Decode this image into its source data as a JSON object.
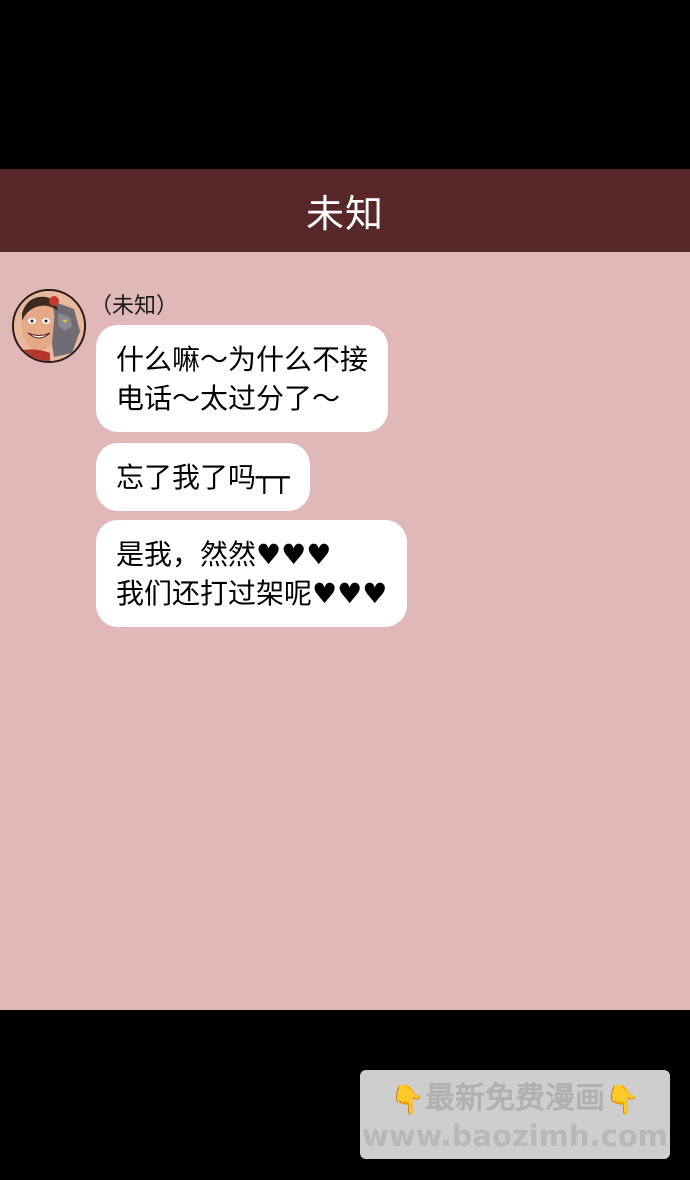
{
  "header": {
    "title": "未知"
  },
  "chat": {
    "sender_name": "（未知）",
    "avatar_icon": "character-avatar-icon",
    "messages": [
      {
        "text": "什么嘛～为什么不接\n电话～太过分了～"
      },
      {
        "text": "忘了我了吗┬┬"
      },
      {
        "text": "是我，然然♥♥♥\n我们还打过架呢♥♥♥"
      }
    ]
  },
  "watermark": {
    "line1": "最新免费漫画",
    "line2": "www.baozimh.com",
    "icon": "pointing-down-hand-icon"
  },
  "colors": {
    "header_bg": "#582828",
    "chat_bg": "#e1b8b8",
    "bubble_bg": "#ffffff"
  }
}
